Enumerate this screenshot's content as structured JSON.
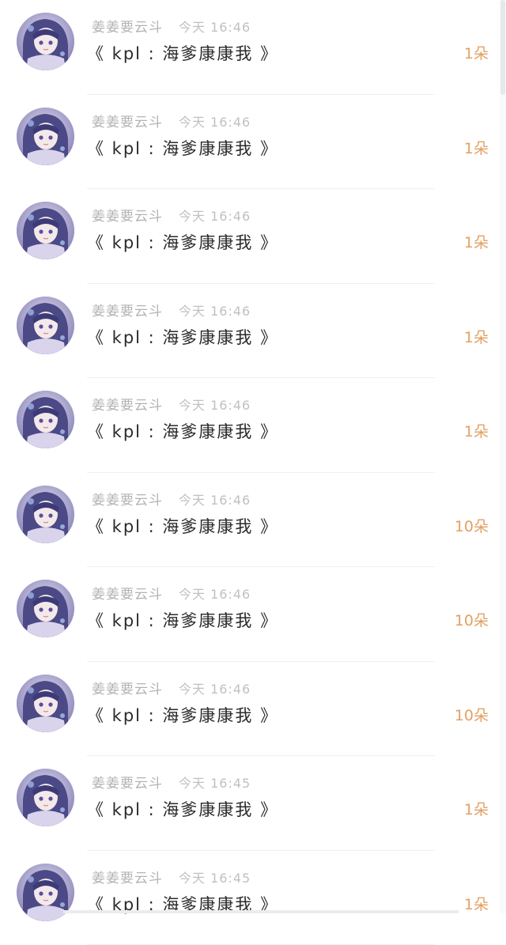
{
  "colors": {
    "background": "#ffffff",
    "username": "#b3b3b3",
    "timestamp": "#c0c0c0",
    "message": "#2a2a2a",
    "count": "#e3a063"
  },
  "avatar_icon": "anime-girl-avatar-icon",
  "messages": [
    {
      "username": "姜姜要云斗",
      "time": "今天 16:46",
      "text": "《 kpl : 海爹康康我 》",
      "count": "1朵"
    },
    {
      "username": "姜姜要云斗",
      "time": "今天 16:46",
      "text": "《 kpl : 海爹康康我 》",
      "count": "1朵"
    },
    {
      "username": "姜姜要云斗",
      "time": "今天 16:46",
      "text": "《 kpl : 海爹康康我 》",
      "count": "1朵"
    },
    {
      "username": "姜姜要云斗",
      "time": "今天 16:46",
      "text": "《 kpl : 海爹康康我 》",
      "count": "1朵"
    },
    {
      "username": "姜姜要云斗",
      "time": "今天 16:46",
      "text": "《 kpl : 海爹康康我 》",
      "count": "1朵"
    },
    {
      "username": "姜姜要云斗",
      "time": "今天 16:46",
      "text": "《 kpl : 海爹康康我 》",
      "count": "10朵"
    },
    {
      "username": "姜姜要云斗",
      "time": "今天 16:46",
      "text": "《 kpl : 海爹康康我 》",
      "count": "10朵"
    },
    {
      "username": "姜姜要云斗",
      "time": "今天 16:46",
      "text": "《 kpl : 海爹康康我 》",
      "count": "10朵"
    },
    {
      "username": "姜姜要云斗",
      "time": "今天 16:45",
      "text": "《 kpl : 海爹康康我 》",
      "count": "1朵"
    },
    {
      "username": "姜姜要云斗",
      "time": "今天 16:45",
      "text": "《 kpl : 海爹康康我 》",
      "count": "1朵"
    }
  ]
}
